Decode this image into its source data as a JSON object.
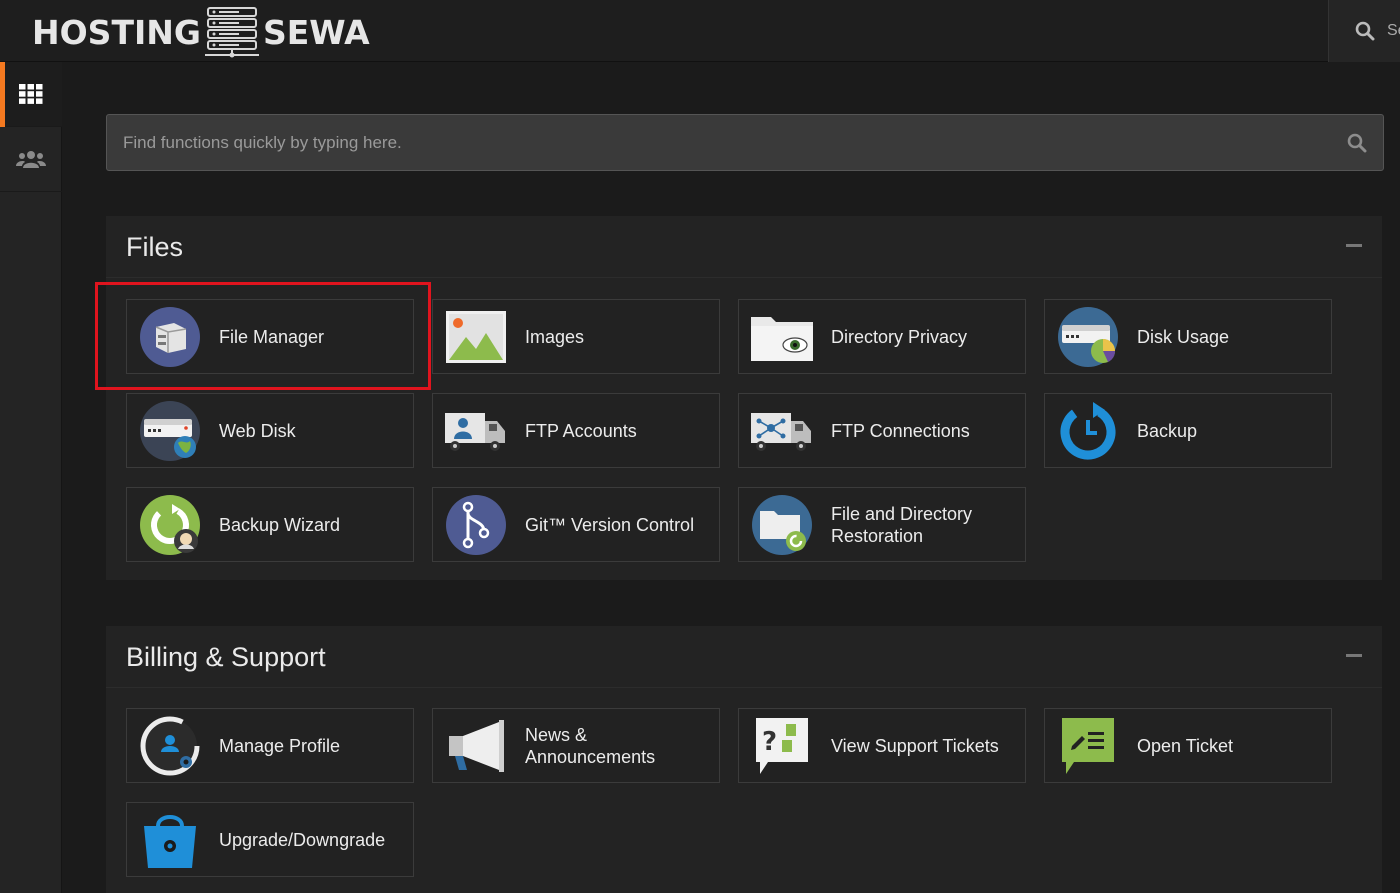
{
  "brand": {
    "left": "HOSTING",
    "right": "SEWA"
  },
  "top_search": {
    "label": "Se"
  },
  "nav": [
    {
      "name": "tools",
      "icon": "grid-icon",
      "active": true
    },
    {
      "name": "users",
      "icon": "users-icon",
      "active": false
    }
  ],
  "search": {
    "placeholder": "Find functions quickly by typing here."
  },
  "sections": {
    "files": {
      "title": "Files",
      "items": [
        {
          "label": "File Manager",
          "icon": "file-manager-icon",
          "highlighted": true
        },
        {
          "label": "Images",
          "icon": "images-icon"
        },
        {
          "label": "Directory Privacy",
          "icon": "directory-privacy-icon"
        },
        {
          "label": "Disk Usage",
          "icon": "disk-usage-icon"
        },
        {
          "label": "Web Disk",
          "icon": "web-disk-icon"
        },
        {
          "label": "FTP Accounts",
          "icon": "ftp-accounts-icon"
        },
        {
          "label": "FTP Connections",
          "icon": "ftp-connections-icon"
        },
        {
          "label": "Backup",
          "icon": "backup-icon"
        },
        {
          "label": "Backup Wizard",
          "icon": "backup-wizard-icon"
        },
        {
          "label": "Git™ Version Control",
          "icon": "git-icon"
        },
        {
          "label": "File and Directory Restoration",
          "icon": "restoration-icon"
        }
      ]
    },
    "billing": {
      "title": "Billing & Support",
      "items": [
        {
          "label": "Manage Profile",
          "icon": "manage-profile-icon"
        },
        {
          "label": "News & Announcements",
          "icon": "megaphone-icon"
        },
        {
          "label": "View Support Tickets",
          "icon": "support-tickets-icon"
        },
        {
          "label": "Open Ticket",
          "icon": "open-ticket-icon"
        },
        {
          "label": "Upgrade/Downgrade",
          "icon": "shopping-bag-icon"
        }
      ]
    }
  },
  "colors": {
    "accent": "#f47920",
    "highlight": "#e0141e",
    "background": "#1b1b1b"
  }
}
